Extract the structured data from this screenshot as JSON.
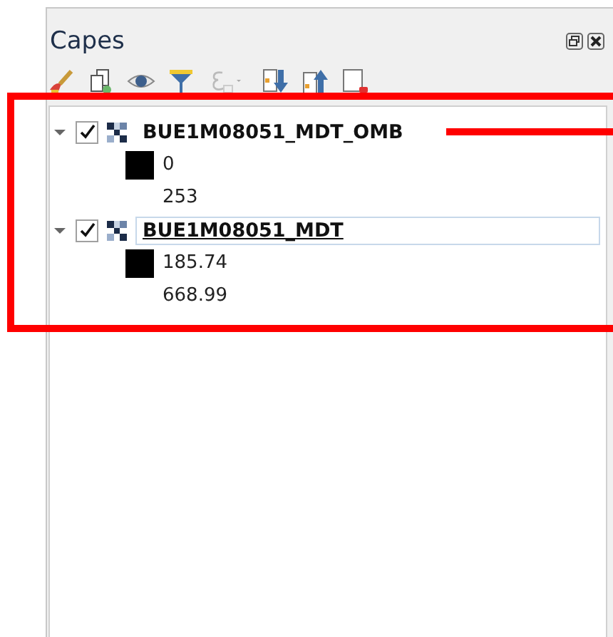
{
  "panel": {
    "title": "Capes"
  },
  "layers": [
    {
      "name": "BUE1M08051_MDT_OMB",
      "expanded": true,
      "checked": true,
      "selected": false,
      "legend": {
        "color": "#000000",
        "min": "0",
        "max": "253"
      }
    },
    {
      "name": "BUE1M08051_MDT",
      "expanded": true,
      "checked": true,
      "selected": true,
      "legend": {
        "color": "#000000",
        "min": "185.74",
        "max": "668.99"
      }
    }
  ]
}
